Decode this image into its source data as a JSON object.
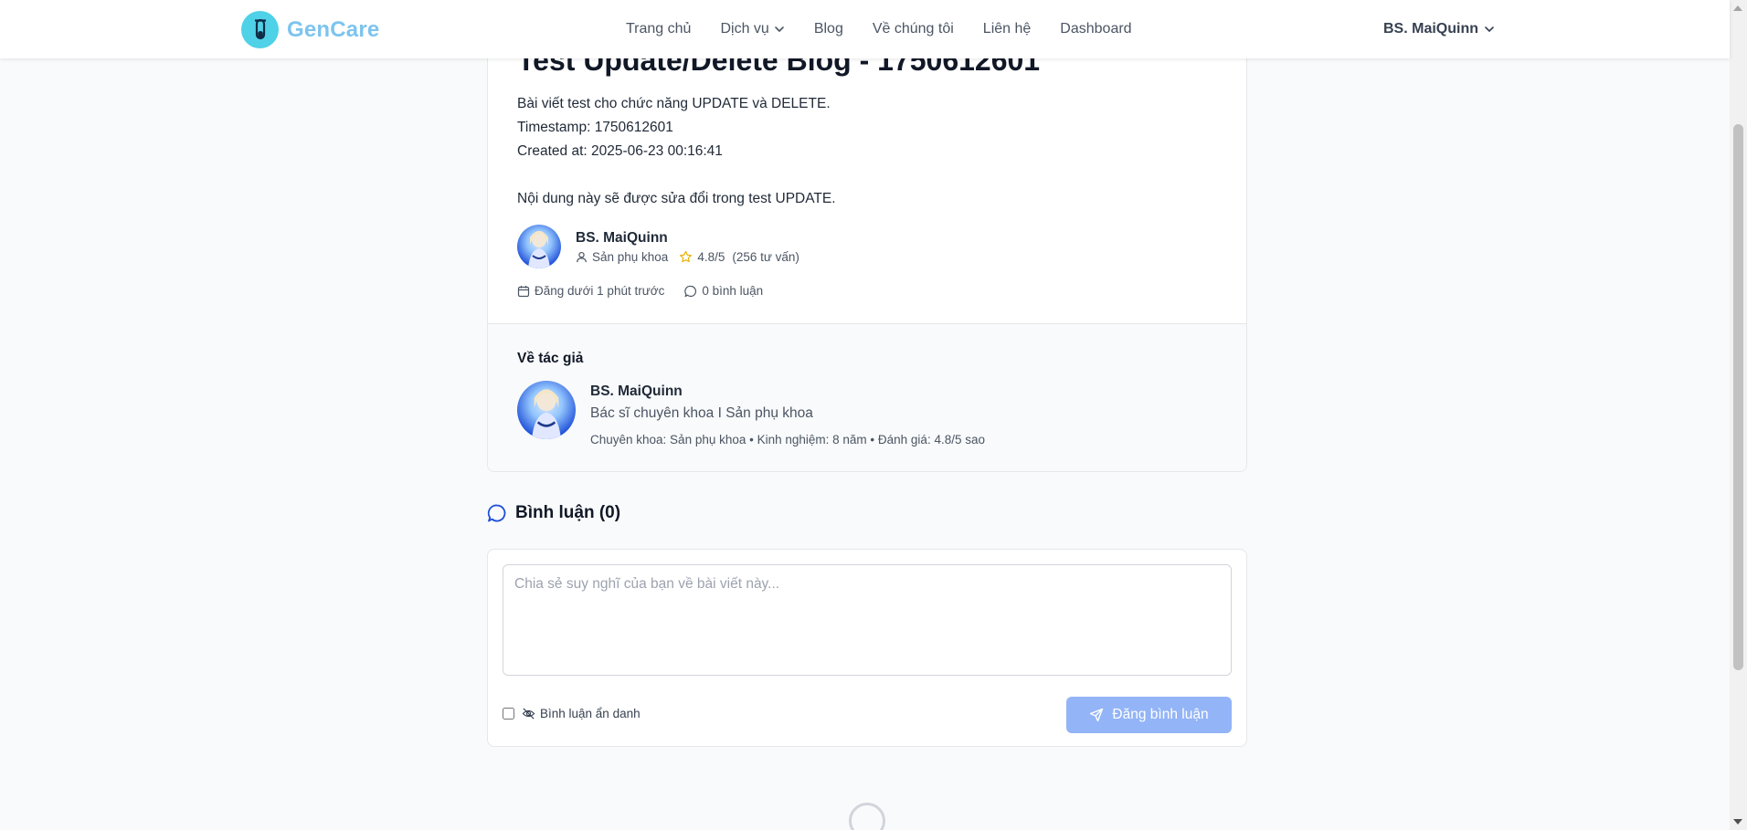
{
  "header": {
    "brand": "GenCare",
    "nav": [
      {
        "label": "Trang chủ"
      },
      {
        "label": "Dịch vụ"
      },
      {
        "label": "Blog"
      },
      {
        "label": "Về chúng tôi"
      },
      {
        "label": "Liên hệ"
      },
      {
        "label": "Dashboard"
      }
    ],
    "user_name": "BS. MaiQuinn"
  },
  "article": {
    "title": "Test Update/Delete Blog - 1750612601",
    "lines": [
      "Bài viết test cho chức năng UPDATE và DELETE.",
      "Timestamp: 1750612601",
      "Created at: 2025-06-23 00:16:41",
      "Nội dung này sẽ được sửa đổi trong test UPDATE."
    ],
    "author": {
      "name": "BS. MaiQuinn",
      "specialty": "Sản phụ khoa",
      "rating": "4.8/5",
      "consultations": "(256 tư vấn)"
    },
    "posted": "Đăng dưới 1 phút trước",
    "comment_count": "0 bình luận"
  },
  "about_author": {
    "title": "Về tác giả",
    "name": "BS. MaiQuinn",
    "role": "Bác sĩ chuyên khoa I Sản phụ khoa",
    "details": "Chuyên khoa: Sản phụ khoa • Kinh nghiệm: 8 năm • Đánh giá: 4.8/5 sao"
  },
  "comments": {
    "heading": "Bình luận (0)",
    "placeholder": "Chia sẻ suy nghĩ của bạn về bài viết này...",
    "anonymous_label": "Bình luận ẩn danh",
    "submit_label": "Đăng bình luận"
  },
  "colors": {
    "brand": "#7dc4ee",
    "logo_badge": "#4fd1e8",
    "primary_disabled": "#93b4f7",
    "accent_blue": "#1d4ed8",
    "star": "#eab308"
  },
  "icons": {
    "logo": "test-tube-icon",
    "dropdown": "chevron-down-icon",
    "specialty": "user-icon",
    "rating": "star-icon",
    "date": "calendar-icon",
    "comments": "message-circle-icon",
    "anonymous": "eye-off-icon",
    "submit": "send-icon"
  }
}
